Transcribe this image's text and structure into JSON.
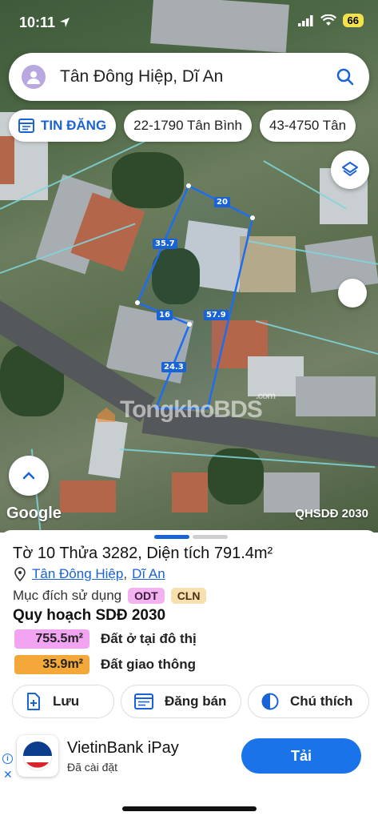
{
  "status_bar": {
    "time": "10:11",
    "battery": "66"
  },
  "search": {
    "query": "Tân Đông Hiệp, Dĩ An"
  },
  "chips": [
    "TIN ĐĂNG",
    "22-1790 Tân Bình",
    "43-4750 Tân"
  ],
  "map": {
    "edge_labels": [
      "20",
      "35.7",
      "57.9",
      "16",
      "24.3"
    ],
    "watermark_brand": "TongkhoBDS",
    "watermark_tld": ".com",
    "attribution": "Google",
    "layer_label": "QHSDĐ 2030"
  },
  "sheet": {
    "title": "Tờ 10 Thửa 3282, Diện tích 791.4m²",
    "ward": "Tân Đông Hiệp",
    "separator": ",",
    "city": "Dĩ An",
    "purpose_label": "Mục đích sử dụng",
    "purpose_tags": [
      "ODT",
      "CLN"
    ],
    "plan_title": "Quy hoạch SDĐ 2030",
    "plan_items": [
      {
        "area": "755.5m²",
        "description": "Đất ở tại đô thị",
        "color": "#f2a3f2"
      },
      {
        "area": "35.9m²",
        "description": "Đất giao thông",
        "color": "#f5a83a"
      }
    ],
    "actions": [
      "Lưu",
      "Đăng bán",
      "Chú thích"
    ]
  },
  "ad": {
    "app_name": "VietinBank iPay",
    "subtitle": "Đã cài đặt",
    "button": "Tải",
    "info_glyph": "i",
    "close_glyph": "✕"
  },
  "colors": {
    "accent": "#1a63d6",
    "parcel_outline": "#1e6df0",
    "ad_button": "#1a73e8"
  }
}
